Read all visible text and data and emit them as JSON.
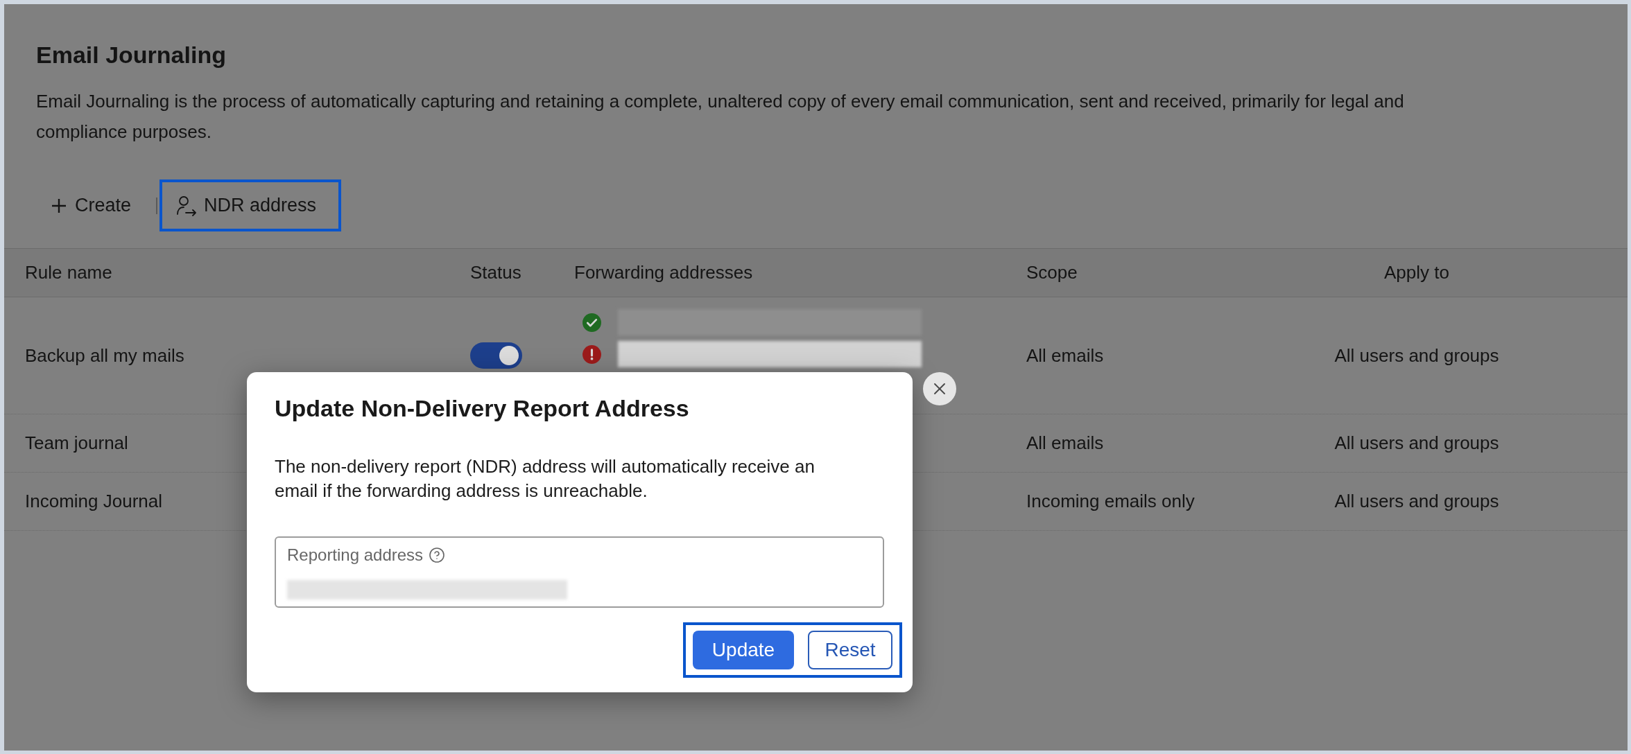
{
  "page": {
    "title": "Email Journaling",
    "description": "Email Journaling is the process of automatically capturing and retaining a complete, unaltered copy of every email communication, sent and received, primarily for legal and compliance purposes."
  },
  "toolbar": [
    {
      "kind": "create",
      "label": "Create",
      "highlighted": false
    },
    {
      "kind": "ndr",
      "label": "NDR address",
      "highlighted": true
    }
  ],
  "table": {
    "columns": [
      "Rule name",
      "Status",
      "Forwarding addresses",
      "Scope",
      "Apply to"
    ],
    "rows": [
      {
        "rule_name": "Backup all my mails",
        "status_on": true,
        "forwarding": [
          {
            "kind": "verified"
          },
          {
            "kind": "failed"
          }
        ],
        "scope": "All emails",
        "apply_to": "All users and groups"
      },
      {
        "rule_name": "Team journal",
        "scope": "All emails",
        "apply_to": "All users and groups"
      },
      {
        "rule_name": "Incoming Journal",
        "scope": "Incoming emails only",
        "apply_to": "All users and groups"
      }
    ]
  },
  "dialog": {
    "title": "Update Non-Delivery Report Address",
    "message": "The non-delivery report (NDR) address will automatically receive an email if the forwarding address is unreachable.",
    "field": {
      "label": "Reporting address"
    },
    "buttons": [
      {
        "kind": "primary",
        "label": "Update"
      },
      {
        "kind": "secondary",
        "label": "Reset"
      }
    ],
    "buttons_highlighted": true
  }
}
